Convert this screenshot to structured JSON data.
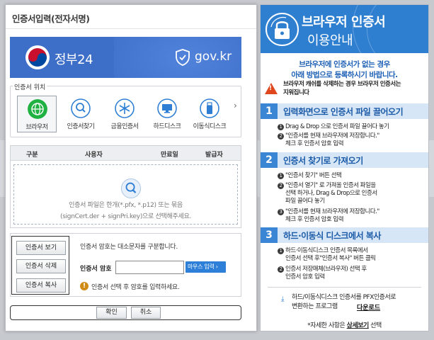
{
  "dialog": {
    "title": "인증서입력(전자서명)",
    "banner": {
      "brand": "정부24",
      "domain": "gov.kr"
    },
    "location": {
      "label": "인증서 위치",
      "items": [
        {
          "label": "브라우저",
          "icon": "globe-icon",
          "selected": true
        },
        {
          "label": "인증서찾기",
          "icon": "magnifier-icon",
          "selected": false
        },
        {
          "label": "금융인증서",
          "icon": "snowflake-icon",
          "selected": false
        },
        {
          "label": "하드디스크",
          "icon": "monitor-icon",
          "selected": false
        },
        {
          "label": "이동식디스크",
          "icon": "usb-icon",
          "selected": false
        }
      ],
      "next_glyph": "›"
    },
    "table": {
      "columns": [
        "구분",
        "사용자",
        "만료일",
        "발급자"
      ],
      "empty_line1": "인증서 파일은 한개(*.pfx, *.p12) 또는 묶음",
      "empty_line2": "(signCert.der + signPri.key)으로 선택해주세요."
    },
    "actions": {
      "view": "인증서 보기",
      "delete": "인증서 삭제",
      "copy": "인증서 복사",
      "password_note": "인증서 암호는 대소문자를 구분합니다.",
      "password_label": "인증서 암호",
      "password_value": "",
      "mouse_input": "마우스 입력 ›",
      "warning": "인증서 선택 후 암호를 입력하세요."
    },
    "buttons": {
      "ok": "확인",
      "cancel": "취소"
    }
  },
  "guide": {
    "title_line1": "브라우저 인증서",
    "title_line2": "이용안내",
    "intro_line1": "브라우저에 인증서가 없는 경우",
    "intro_line2": "아래 방법으로 등록하시기 바랍니다.",
    "warning_line1": "브라우저 캐쉬를 삭제하는 경우 브라우저 인증서는",
    "warning_line2": "지워집니다",
    "steps": [
      {
        "num": "1",
        "title": "입력화면으로 인증서 파일 끌어오기",
        "items": [
          {
            "n": "1",
            "lines": [
              "Drag & Drop 으로 인증서 파일 끌어다 놓기"
            ]
          },
          {
            "n": "2",
            "lines": [
              "\"인증서를 현재 브라우저에 저장합니다.\"",
              "체크 후 인증서 암호 입력"
            ]
          }
        ]
      },
      {
        "num": "2",
        "title": "인증서 찾기로 가져오기",
        "items": [
          {
            "n": "1",
            "lines": [
              "\"인증서 찾기\" 버튼 선택"
            ]
          },
          {
            "n": "2",
            "lines": [
              "\"인증서 열기\" 로 가져올 인증서 파일을",
              "선택 하거나, Drag & Drop으로 인증서",
              "파일 끌어다 놓기"
            ]
          },
          {
            "n": "3",
            "lines": [
              "\"인증서를 현재 브라우저에 저장합니다.\"",
              "체크 후 인증서 암호 입력"
            ]
          }
        ]
      },
      {
        "num": "3",
        "title": "하드·이동식 디스크에서 복사",
        "items": [
          {
            "n": "1",
            "lines": [
              "하드·이동식디스크 인증서 목록에서",
              "인증서 선택 후\"인증서 복사\" 버튼 클릭"
            ]
          },
          {
            "n": "2",
            "lines": [
              "인증서 저장매체(브라우저) 선택 후",
              "인증서 암호 입력"
            ]
          }
        ]
      }
    ],
    "download_line1": "하드/이동식디스크 인증서를 PFX인증서로",
    "download_line2": "변환하는 프로그램",
    "download_link": "다운로드",
    "detail_prefix": "*자세한 사항은",
    "detail_link": "상세보기",
    "detail_suffix": "선택"
  },
  "colors": {
    "banner_blue": "#3d6ec8",
    "guide_blue": "#2f7fd1",
    "step_bar": "#d6e6f6",
    "mouse_button": "#2d7fd8"
  }
}
